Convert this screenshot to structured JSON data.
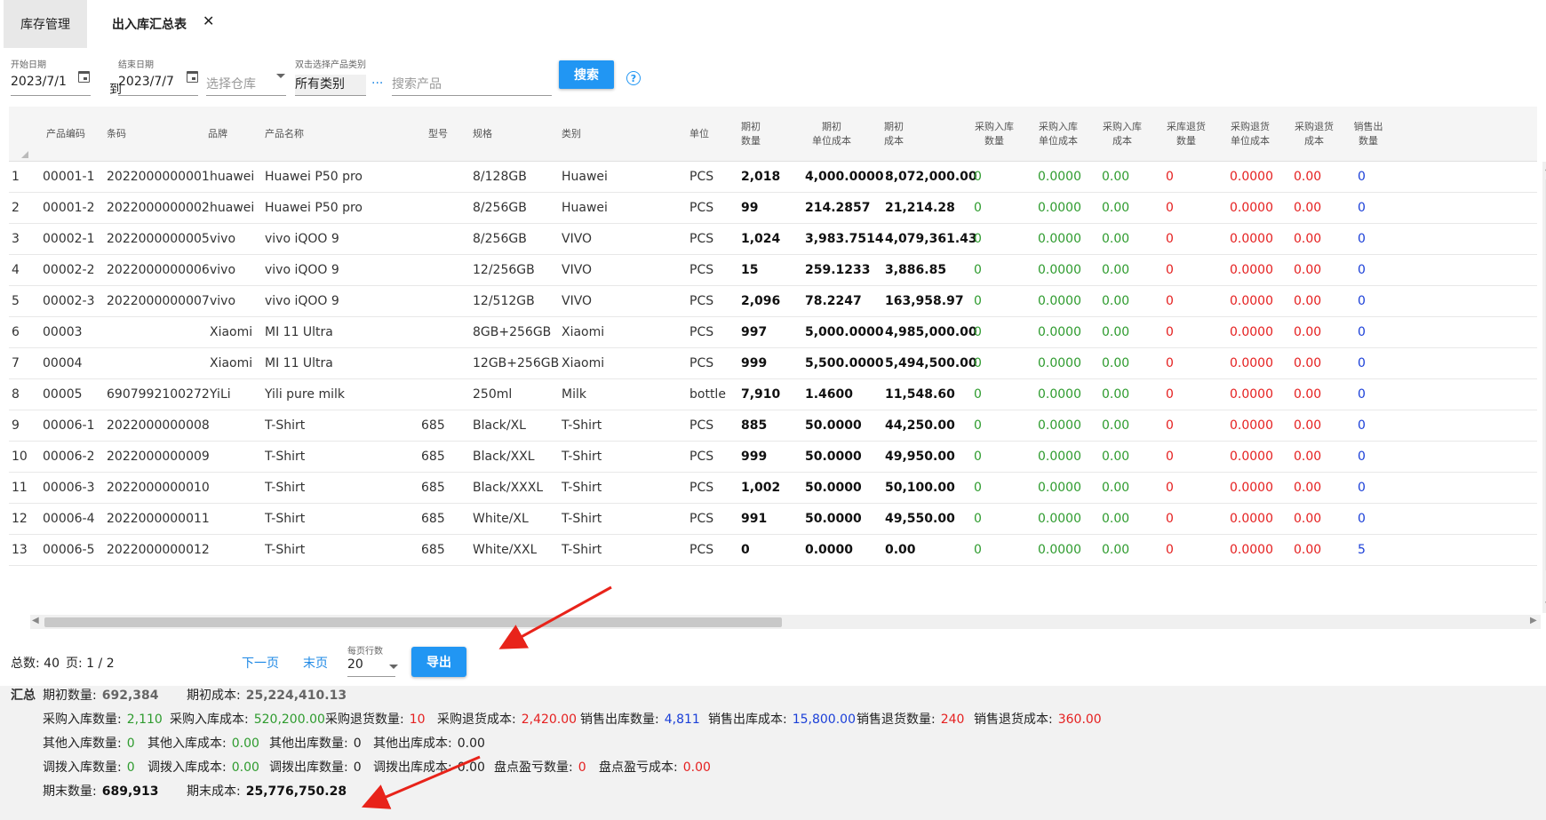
{
  "tabs": [
    {
      "label": "库存管理",
      "active": false
    },
    {
      "label": "出入库汇总表",
      "active": true
    }
  ],
  "filters": {
    "start_date": {
      "label": "开始日期",
      "value": "2023/7/1"
    },
    "to_label": "到",
    "end_date": {
      "label": "结束日期",
      "value": "2023/7/7"
    },
    "warehouse": {
      "placeholder": "选择仓库"
    },
    "category": {
      "label": "双击选择产品类别",
      "value": "所有类别"
    },
    "category_more": "...",
    "product_search": {
      "placeholder": "搜索产品"
    },
    "search_label": "搜索",
    "help_label": "?"
  },
  "table": {
    "columns": [
      {
        "key": "code",
        "label": [
          "产品编码"
        ]
      },
      {
        "key": "barcode",
        "label": [
          "条码"
        ]
      },
      {
        "key": "brand",
        "label": [
          "品牌"
        ]
      },
      {
        "key": "name",
        "label": [
          "产品名称"
        ]
      },
      {
        "key": "model",
        "label": [
          "型号"
        ]
      },
      {
        "key": "spec",
        "label": [
          "规格"
        ]
      },
      {
        "key": "category",
        "label": [
          "类别"
        ]
      },
      {
        "key": "unit",
        "label": [
          "单位"
        ]
      },
      {
        "key": "open_qty",
        "label": [
          "期初",
          "数量"
        ]
      },
      {
        "key": "open_unit_cost",
        "label": [
          "期初",
          "单位成本"
        ]
      },
      {
        "key": "open_cost",
        "label": [
          "期初",
          "成本"
        ]
      },
      {
        "key": "pur_in_qty",
        "label": [
          "采购入库",
          "数量"
        ]
      },
      {
        "key": "pur_in_unit_cost",
        "label": [
          "采购入库",
          "单位成本"
        ]
      },
      {
        "key": "pur_in_cost",
        "label": [
          "采购入库",
          "成本"
        ]
      },
      {
        "key": "pur_ret_qty",
        "label": [
          "采库退货",
          "数量"
        ]
      },
      {
        "key": "pur_ret_unit_cost",
        "label": [
          "采购退货",
          "单位成本"
        ]
      },
      {
        "key": "pur_ret_cost",
        "label": [
          "采购退货",
          "成本"
        ]
      },
      {
        "key": "sale_out_qty",
        "label": [
          "销售出",
          "数量"
        ]
      }
    ],
    "rows": [
      {
        "n": "1",
        "code": "00001-1",
        "barcode": "2022000000001",
        "brand": "huawei",
        "name": "Huawei P50 pro",
        "model": "",
        "spec": "8/128GB",
        "category": "Huawei",
        "unit": "PCS",
        "open_qty": "2,018",
        "open_unit_cost": "4,000.0000",
        "open_cost": "8,072,000.00",
        "pur_in_qty": "0",
        "pur_in_unit_cost": "0.0000",
        "pur_in_cost": "0.00",
        "pur_ret_qty": "0",
        "pur_ret_unit_cost": "0.0000",
        "pur_ret_cost": "0.00",
        "sale_out_qty": "0"
      },
      {
        "n": "2",
        "code": "00001-2",
        "barcode": "2022000000002",
        "brand": "huawei",
        "name": "Huawei P50 pro",
        "model": "",
        "spec": "8/256GB",
        "category": "Huawei",
        "unit": "PCS",
        "open_qty": "99",
        "open_unit_cost": "214.2857",
        "open_cost": "21,214.28",
        "pur_in_qty": "0",
        "pur_in_unit_cost": "0.0000",
        "pur_in_cost": "0.00",
        "pur_ret_qty": "0",
        "pur_ret_unit_cost": "0.0000",
        "pur_ret_cost": "0.00",
        "sale_out_qty": "0"
      },
      {
        "n": "3",
        "code": "00002-1",
        "barcode": "2022000000005",
        "brand": "vivo",
        "name": "vivo iQOO 9",
        "model": "",
        "spec": "8/256GB",
        "category": "VIVO",
        "unit": "PCS",
        "open_qty": "1,024",
        "open_unit_cost": "3,983.7514",
        "open_cost": "4,079,361.43",
        "pur_in_qty": "0",
        "pur_in_unit_cost": "0.0000",
        "pur_in_cost": "0.00",
        "pur_ret_qty": "0",
        "pur_ret_unit_cost": "0.0000",
        "pur_ret_cost": "0.00",
        "sale_out_qty": "0"
      },
      {
        "n": "4",
        "code": "00002-2",
        "barcode": "2022000000006",
        "brand": "vivo",
        "name": "vivo iQOO 9",
        "model": "",
        "spec": "12/256GB",
        "category": "VIVO",
        "unit": "PCS",
        "open_qty": "15",
        "open_unit_cost": "259.1233",
        "open_cost": "3,886.85",
        "pur_in_qty": "0",
        "pur_in_unit_cost": "0.0000",
        "pur_in_cost": "0.00",
        "pur_ret_qty": "0",
        "pur_ret_unit_cost": "0.0000",
        "pur_ret_cost": "0.00",
        "sale_out_qty": "0"
      },
      {
        "n": "5",
        "code": "00002-3",
        "barcode": "2022000000007",
        "brand": "vivo",
        "name": "vivo iQOO 9",
        "model": "",
        "spec": "12/512GB",
        "category": "VIVO",
        "unit": "PCS",
        "open_qty": "2,096",
        "open_unit_cost": "78.2247",
        "open_cost": "163,958.97",
        "pur_in_qty": "0",
        "pur_in_unit_cost": "0.0000",
        "pur_in_cost": "0.00",
        "pur_ret_qty": "0",
        "pur_ret_unit_cost": "0.0000",
        "pur_ret_cost": "0.00",
        "sale_out_qty": "0"
      },
      {
        "n": "6",
        "code": "00003",
        "barcode": "",
        "brand": "Xiaomi",
        "name": "MI 11 Ultra",
        "model": "",
        "spec": "8GB+256GB",
        "category": "Xiaomi",
        "unit": "PCS",
        "open_qty": "997",
        "open_unit_cost": "5,000.0000",
        "open_cost": "4,985,000.00",
        "pur_in_qty": "0",
        "pur_in_unit_cost": "0.0000",
        "pur_in_cost": "0.00",
        "pur_ret_qty": "0",
        "pur_ret_unit_cost": "0.0000",
        "pur_ret_cost": "0.00",
        "sale_out_qty": "0"
      },
      {
        "n": "7",
        "code": "00004",
        "barcode": "",
        "brand": "Xiaomi",
        "name": "MI 11 Ultra",
        "model": "",
        "spec": "12GB+256GB",
        "category": "Xiaomi",
        "unit": "PCS",
        "open_qty": "999",
        "open_unit_cost": "5,500.0000",
        "open_cost": "5,494,500.00",
        "pur_in_qty": "0",
        "pur_in_unit_cost": "0.0000",
        "pur_in_cost": "0.00",
        "pur_ret_qty": "0",
        "pur_ret_unit_cost": "0.0000",
        "pur_ret_cost": "0.00",
        "sale_out_qty": "0"
      },
      {
        "n": "8",
        "code": "00005",
        "barcode": "6907992100272",
        "brand": "YiLi",
        "name": "Yili pure milk",
        "model": "",
        "spec": "250ml",
        "category": "Milk",
        "unit": "bottle",
        "open_qty": "7,910",
        "open_unit_cost": "1.4600",
        "open_cost": "11,548.60",
        "pur_in_qty": "0",
        "pur_in_unit_cost": "0.0000",
        "pur_in_cost": "0.00",
        "pur_ret_qty": "0",
        "pur_ret_unit_cost": "0.0000",
        "pur_ret_cost": "0.00",
        "sale_out_qty": "0"
      },
      {
        "n": "9",
        "code": "00006-1",
        "barcode": "2022000000008",
        "brand": "",
        "name": "T-Shirt",
        "model": "685",
        "spec": "Black/XL",
        "category": "T-Shirt",
        "unit": "PCS",
        "open_qty": "885",
        "open_unit_cost": "50.0000",
        "open_cost": "44,250.00",
        "pur_in_qty": "0",
        "pur_in_unit_cost": "0.0000",
        "pur_in_cost": "0.00",
        "pur_ret_qty": "0",
        "pur_ret_unit_cost": "0.0000",
        "pur_ret_cost": "0.00",
        "sale_out_qty": "0"
      },
      {
        "n": "10",
        "code": "00006-2",
        "barcode": "2022000000009",
        "brand": "",
        "name": "T-Shirt",
        "model": "685",
        "spec": "Black/XXL",
        "category": "T-Shirt",
        "unit": "PCS",
        "open_qty": "999",
        "open_unit_cost": "50.0000",
        "open_cost": "49,950.00",
        "pur_in_qty": "0",
        "pur_in_unit_cost": "0.0000",
        "pur_in_cost": "0.00",
        "pur_ret_qty": "0",
        "pur_ret_unit_cost": "0.0000",
        "pur_ret_cost": "0.00",
        "sale_out_qty": "0"
      },
      {
        "n": "11",
        "code": "00006-3",
        "barcode": "2022000000010",
        "brand": "",
        "name": "T-Shirt",
        "model": "685",
        "spec": "Black/XXXL",
        "category": "T-Shirt",
        "unit": "PCS",
        "open_qty": "1,002",
        "open_unit_cost": "50.0000",
        "open_cost": "50,100.00",
        "pur_in_qty": "0",
        "pur_in_unit_cost": "0.0000",
        "pur_in_cost": "0.00",
        "pur_ret_qty": "0",
        "pur_ret_unit_cost": "0.0000",
        "pur_ret_cost": "0.00",
        "sale_out_qty": "0"
      },
      {
        "n": "12",
        "code": "00006-4",
        "barcode": "2022000000011",
        "brand": "",
        "name": "T-Shirt",
        "model": "685",
        "spec": "White/XL",
        "category": "T-Shirt",
        "unit": "PCS",
        "open_qty": "991",
        "open_unit_cost": "50.0000",
        "open_cost": "49,550.00",
        "pur_in_qty": "0",
        "pur_in_unit_cost": "0.0000",
        "pur_in_cost": "0.00",
        "pur_ret_qty": "0",
        "pur_ret_unit_cost": "0.0000",
        "pur_ret_cost": "0.00",
        "sale_out_qty": "0"
      },
      {
        "n": "13",
        "code": "00006-5",
        "barcode": "2022000000012",
        "brand": "",
        "name": "T-Shirt",
        "model": "685",
        "spec": "White/XXL",
        "category": "T-Shirt",
        "unit": "PCS",
        "open_qty": "0",
        "open_unit_cost": "0.0000",
        "open_cost": "0.00",
        "pur_in_qty": "0",
        "pur_in_unit_cost": "0.0000",
        "pur_in_cost": "0.00",
        "pur_ret_qty": "0",
        "pur_ret_unit_cost": "0.0000",
        "pur_ret_cost": "0.00",
        "sale_out_qty": "5"
      }
    ]
  },
  "pager": {
    "total_label": "总数: 40",
    "page_label": "页: 1 / 2",
    "next_label": "下一页",
    "last_label": "末页",
    "page_size_label": "每页行数",
    "page_size_value": "20",
    "export_label": "导出"
  },
  "summary": {
    "title": "汇总",
    "open_qty": {
      "label": "期初数量:",
      "value": "692,384"
    },
    "open_cost": {
      "label": "期初成本:",
      "value": "25,224,410.13"
    },
    "pur_in_qty": {
      "label": "采购入库数量:",
      "value": "2,110"
    },
    "pur_in_cost": {
      "label": "采购入库成本:",
      "value": "520,200.00"
    },
    "pur_ret_qty": {
      "label": "采购退货数量:",
      "value": "10"
    },
    "pur_ret_cost": {
      "label": "采购退货成本:",
      "value": "2,420.00"
    },
    "sale_out_qty": {
      "label": "销售出库数量:",
      "value": "4,811"
    },
    "sale_out_cost": {
      "label": "销售出库成本:",
      "value": "15,800.00"
    },
    "sale_ret_qty": {
      "label": "销售退货数量:",
      "value": "240"
    },
    "sale_ret_cost": {
      "label": "销售退货成本:",
      "value": "360.00"
    },
    "other_in_qty": {
      "label": "其他入库数量:",
      "value": "0"
    },
    "other_in_cost": {
      "label": "其他入库成本:",
      "value": "0.00"
    },
    "other_out_qty": {
      "label": "其他出库数量:",
      "value": "0"
    },
    "other_out_cost": {
      "label": "其他出库成本:",
      "value": "0.00"
    },
    "trans_in_qty": {
      "label": "调拨入库数量:",
      "value": "0"
    },
    "trans_in_cost": {
      "label": "调拨入库成本:",
      "value": "0.00"
    },
    "trans_out_qty": {
      "label": "调拨出库数量:",
      "value": "0"
    },
    "trans_out_cost": {
      "label": "调拨出库成本:",
      "value": "0.00"
    },
    "stock_diff_qty": {
      "label": "盘点盈亏数量:",
      "value": "0"
    },
    "stock_diff_cost": {
      "label": "盘点盈亏成本:",
      "value": "0.00"
    },
    "close_qty": {
      "label": "期末数量:",
      "value": "689,913"
    },
    "close_cost": {
      "label": "期末成本:",
      "value": "25,776,750.28"
    }
  },
  "colors": {
    "accent": "#2196f3",
    "positive": "#2e9b2e",
    "negative": "#e52020",
    "sales": "#1a3fd8",
    "annotation_arrow": "#e8231a"
  }
}
